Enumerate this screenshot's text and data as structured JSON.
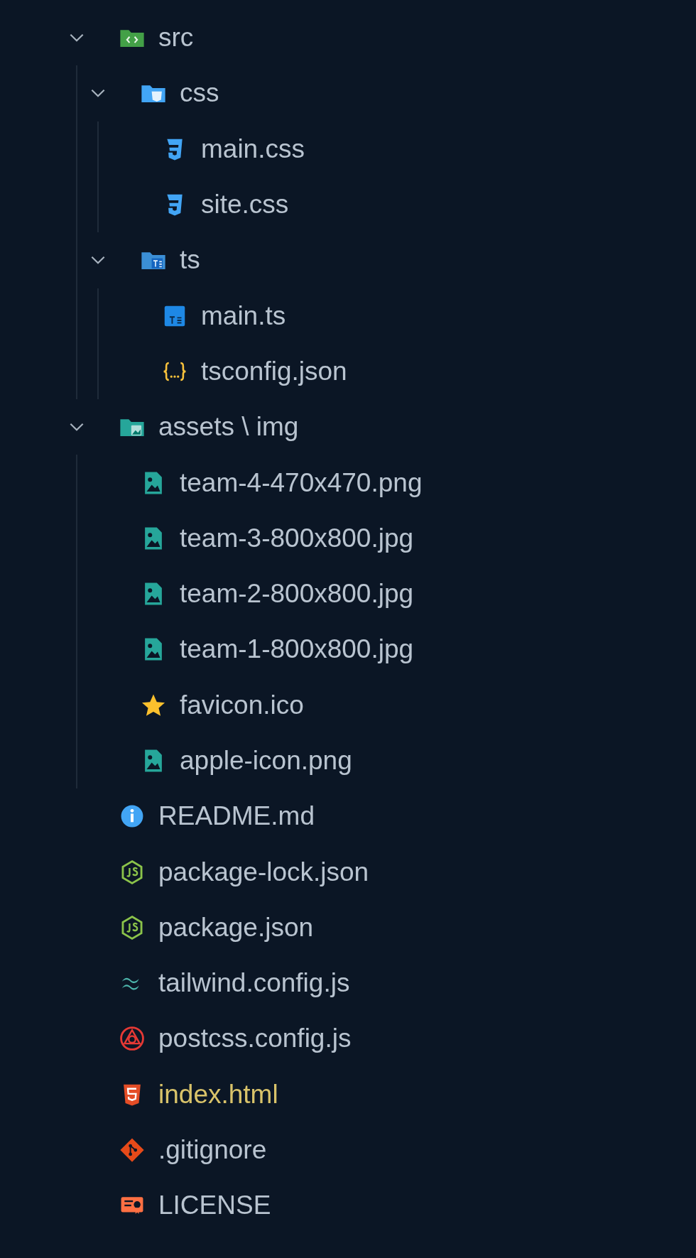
{
  "tree": [
    {
      "name": "src",
      "kind": "folder-src",
      "expanded": true,
      "children": [
        {
          "name": "css",
          "kind": "folder-css",
          "expanded": true,
          "children": [
            {
              "name": "main.css",
              "kind": "css",
              "modified": false
            },
            {
              "name": "site.css",
              "kind": "css",
              "modified": false
            }
          ]
        },
        {
          "name": "ts",
          "kind": "folder-ts",
          "expanded": true,
          "children": [
            {
              "name": "main.ts",
              "kind": "ts",
              "modified": false
            },
            {
              "name": "tsconfig.json",
              "kind": "json",
              "modified": false
            }
          ]
        }
      ]
    },
    {
      "name": "assets \\ img",
      "kind": "folder-images",
      "expanded": true,
      "children": [
        {
          "name": "team-4-470x470.png",
          "kind": "image",
          "modified": false
        },
        {
          "name": "team-3-800x800.jpg",
          "kind": "image",
          "modified": false
        },
        {
          "name": "team-2-800x800.jpg",
          "kind": "image",
          "modified": false
        },
        {
          "name": "team-1-800x800.jpg",
          "kind": "image",
          "modified": false
        },
        {
          "name": "favicon.ico",
          "kind": "star",
          "modified": false
        },
        {
          "name": "apple-icon.png",
          "kind": "image",
          "modified": false
        }
      ]
    },
    {
      "name": "README.md",
      "kind": "info",
      "modified": false
    },
    {
      "name": "package-lock.json",
      "kind": "npm",
      "modified": false
    },
    {
      "name": "package.json",
      "kind": "npm",
      "modified": false
    },
    {
      "name": "tailwind.config.js",
      "kind": "tailwind",
      "modified": false
    },
    {
      "name": "postcss.config.js",
      "kind": "postcss",
      "modified": false
    },
    {
      "name": "index.html",
      "kind": "html",
      "modified": true
    },
    {
      "name": ".gitignore",
      "kind": "git",
      "modified": false
    },
    {
      "name": "LICENSE",
      "kind": "license",
      "modified": false
    }
  ]
}
